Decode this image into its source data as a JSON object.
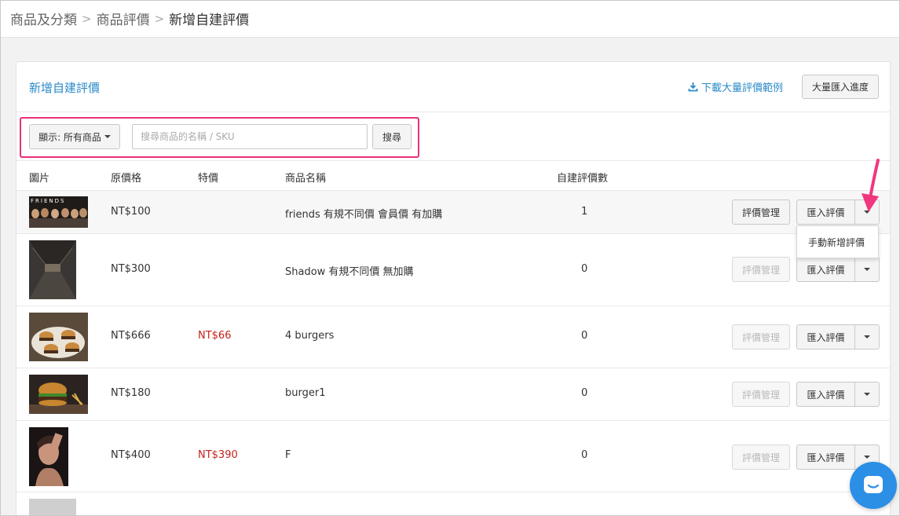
{
  "breadcrumb": [
    "商品及分類",
    "商品評價",
    "新增自建評價"
  ],
  "panel": {
    "title": "新增自建評價",
    "download_link": "下載大量評價範例",
    "progress_button": "大量匯入進度"
  },
  "filter": {
    "show_label": "顯示: 所有商品",
    "search_placeholder": "搜尋商品的名稱 / SKU",
    "search_button": "搜尋"
  },
  "table": {
    "headers": {
      "image": "圖片",
      "original_price": "原價格",
      "special_price": "特價",
      "name": "商品名稱",
      "review_count": "自建評價數"
    },
    "rows": [
      {
        "image": "friends-poster",
        "original_price": "NT$100",
        "special_price": "",
        "name": "friends 有規不同價 會員價 有加購",
        "review_count": "1",
        "manage_enabled": true
      },
      {
        "image": "tunnel-photo",
        "original_price": "NT$300",
        "special_price": "",
        "name": "Shadow 有規不同價 無加購",
        "review_count": "0",
        "manage_enabled": false
      },
      {
        "image": "burgers-photo",
        "original_price": "NT$666",
        "special_price": "NT$66",
        "name": "4 burgers",
        "review_count": "0",
        "manage_enabled": false
      },
      {
        "image": "burger-photo",
        "original_price": "NT$180",
        "special_price": "",
        "name": "burger1",
        "review_count": "0",
        "manage_enabled": false
      },
      {
        "image": "portrait-photo",
        "original_price": "NT$400",
        "special_price": "NT$390",
        "name": "F",
        "review_count": "0",
        "manage_enabled": false
      }
    ],
    "manage_button": "評價管理",
    "import_button": "匯入評價"
  },
  "dropdown": {
    "item": "手動新增評價"
  },
  "thumb_text": "FRIENDS",
  "colors": {
    "accent": "#2a8ac9",
    "highlight": "#e8317a",
    "special_price": "#c7221a",
    "chat": "#2b8fe6"
  }
}
